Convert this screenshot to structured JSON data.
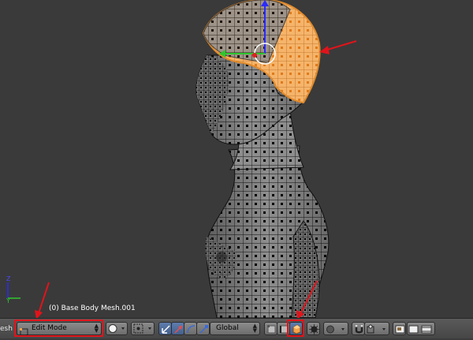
{
  "viewport": {
    "object_label": "(0) Base Body Mesh.001"
  },
  "header": {
    "editor_type_label": "esh",
    "interaction_mode": {
      "selected": "Edit Mode",
      "icon": "edit-mode-icon"
    },
    "viewport_shading_icon": "solid-sphere-icon",
    "pivot_point_icon": "pivot-point-icon",
    "manipulator_icons": [
      "manipulator-toggle-icon",
      "translate-arrow-icon",
      "rotate-arc-icon",
      "scale-icon"
    ],
    "transform_orientation": {
      "selected": "Global"
    },
    "select_mode_icons": [
      "vertex-select-icon",
      "edge-select-icon",
      "face-select-icon"
    ],
    "occlude_geometry_icon": "limit-selection-to-visible-icon",
    "proportional_editing_icon": "proportional-edit-icon",
    "snap_icons": [
      "snap-magnet-icon",
      "snap-element-icon"
    ],
    "render_icons": [
      "opengl-render-image-icon",
      "opengl-render-animation-icon"
    ]
  },
  "colors": {
    "annotation_red": "#e0141b",
    "selection_orange": "#f2a24a",
    "header_bg": "#505050",
    "viewport_bg": "#3a3a3a"
  }
}
